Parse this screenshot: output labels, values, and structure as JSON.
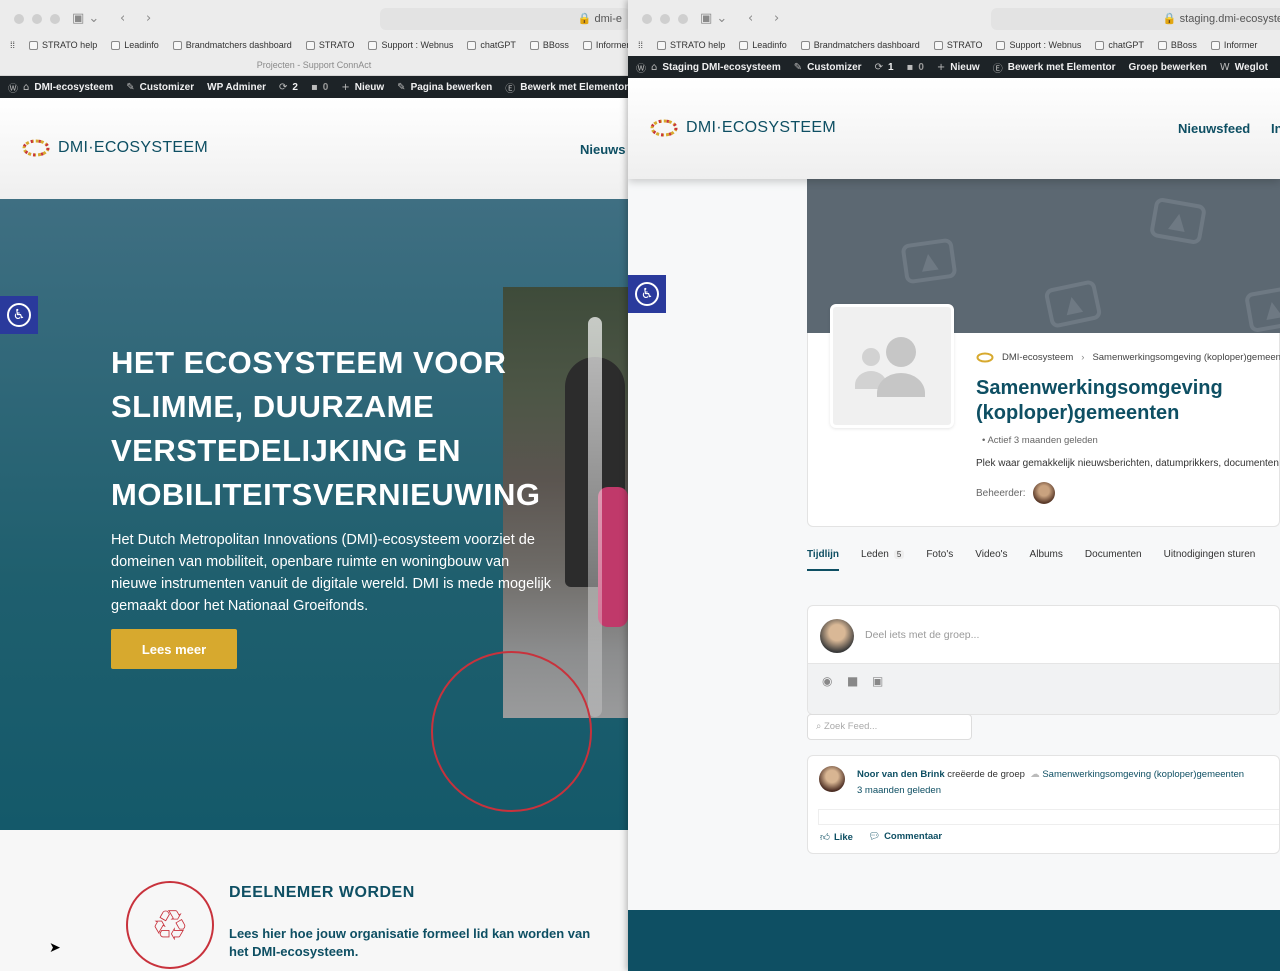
{
  "left": {
    "url": "dmi-e",
    "subtitle": "Projecten - Support ConnAct",
    "bookmarks": [
      "STRATO help",
      "Leadinfo",
      "Brandmatchers dashboard",
      "STRATO",
      "Support : Webnus",
      "chatGPT",
      "BBoss",
      "Informer"
    ],
    "wpbar": {
      "site": "DMI-ecosysteem",
      "customizer": "Customizer",
      "wpadminer": "WP Adminer",
      "updates": "2",
      "comments": "0",
      "new": "Nieuw",
      "edit_page": "Pagina bewerken",
      "elementor": "Bewerk met Elementor"
    },
    "logo": "DMI·ECOSYSTEEM",
    "nav": "Nieuws",
    "hero": {
      "title": "HET ECOSYSTEEM VOOR SLIMME, DUURZAME VERSTEDELIJKING EN MOBILITEITSVERNIEUWING",
      "text": "Het Dutch Metropolitan Innovations (DMI)-ecosysteem voorziet de domeinen van mobiliteit, openbare ruimte en woningbouw van nieuwe instrumenten vanuit de digitale wereld. DMI is mede mogelijk gemaakt door het Nationaal Groeifonds.",
      "button": "Lees meer"
    },
    "deelnemer": {
      "title": "DEELNEMER WORDEN",
      "text": "Lees hier hoe jouw organisatie formeel lid kan worden van het DMI-ecosysteem."
    }
  },
  "right": {
    "url": "staging.dmi-ecosyste",
    "bookmarks": [
      "STRATO help",
      "Leadinfo",
      "Brandmatchers dashboard",
      "STRATO",
      "Support : Webnus",
      "chatGPT",
      "BBoss",
      "Informer"
    ],
    "wpbar": {
      "site": "Staging DMI-ecosysteem",
      "customizer": "Customizer",
      "updates": "1",
      "comments": "0",
      "new": "Nieuw",
      "elementor": "Bewerk met Elementor",
      "group_edit": "Groep bewerken",
      "weglot": "Weglot"
    },
    "logo": "DMI·ECOSYSTEEM",
    "nav": [
      "Nieuwsfeed",
      "In"
    ],
    "group": {
      "crumb_root": "DMI-ecosysteem",
      "crumb_current": "Samenwerkingsomgeving (koploper)gemeen",
      "title": "Samenwerkingsomgeving (koploper)gemeenten",
      "active": "Actief 3 maanden geleden",
      "description": "Plek waar gemakkelijk nieuwsberichten, datumprikkers, documenten",
      "admin_label": "Beheerder:"
    },
    "tabs": [
      {
        "label": "Tijdlijn"
      },
      {
        "label": "Leden",
        "badge": "5"
      },
      {
        "label": "Foto's"
      },
      {
        "label": "Video's"
      },
      {
        "label": "Albums"
      },
      {
        "label": "Documenten"
      },
      {
        "label": "Uitnodigingen sturen"
      }
    ],
    "post_placeholder": "Deel iets met de groep...",
    "search_placeholder": "Zoek Feed...",
    "feed": {
      "author": "Noor van den Brink",
      "action": "creëerde de groep",
      "group": "Samenwerkingsomgeving (koploper)gemeenten",
      "time": "3 maanden geleden",
      "like": "Like",
      "comment": "Commentaar"
    }
  },
  "colors": {
    "brand": "#0e4f63",
    "gold": "#d7a92e",
    "red": "#c8323c",
    "a11y": "#2a3a9c"
  }
}
